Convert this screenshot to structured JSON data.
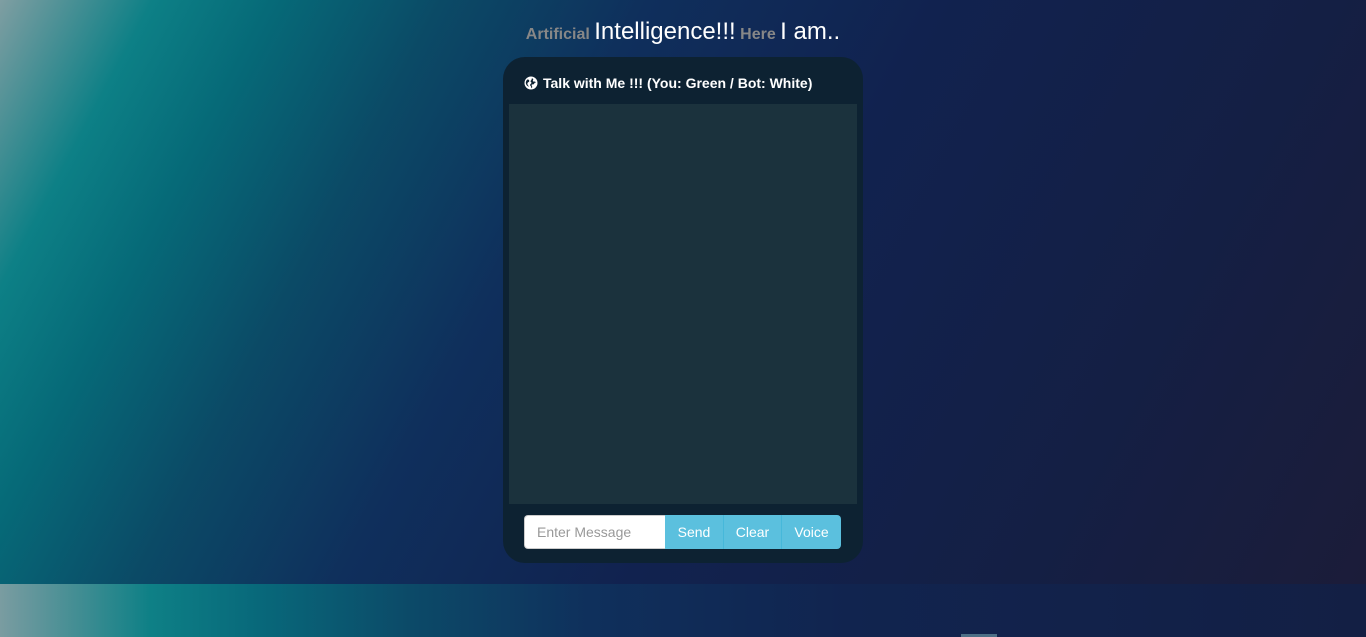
{
  "headline": {
    "word1": "Artificial",
    "word2": "Intelligence!!!",
    "word3": "Here",
    "word4": "I am.."
  },
  "chat": {
    "title": "Talk with Me !!! (You: Green / Bot: White)",
    "title_icon": "globe-icon",
    "messages": [],
    "input": {
      "value": "",
      "placeholder": "Enter Message"
    },
    "buttons": {
      "send": "Send",
      "clear": "Clear",
      "voice": "Voice"
    }
  },
  "colors": {
    "panel": "#0d2232",
    "chat_area": "#1b323d",
    "button": "#5bc0de",
    "you_text": "green",
    "bot_text": "white"
  }
}
